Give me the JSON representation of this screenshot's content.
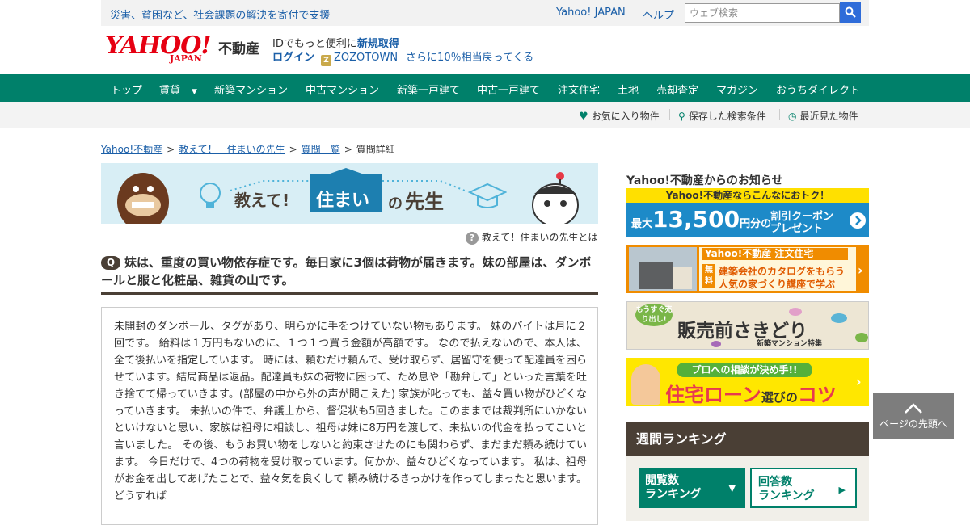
{
  "topbar": {
    "tagline": "災害、貧困など、社会課題の解決を寄付で支援",
    "yahoo_japan": "Yahoo! JAPAN",
    "help": "ヘルプ",
    "search_placeholder": "ウェブ検索"
  },
  "logo": {
    "yahoo": "YAHOO!",
    "japan": "JAPAN",
    "fudosan": "不動産"
  },
  "account": {
    "id_prefix": "IDでもっと便利に",
    "new_id": "新規取得",
    "login": "ログイン",
    "zozo": "ZOZOTOWN",
    "zozo_bonus": "さらに10％相当戻ってくる"
  },
  "nav": [
    "トップ",
    "賃貸",
    "新築マンション",
    "中古マンション",
    "新築一戸建て",
    "中古一戸建て",
    "注文住宅",
    "土地",
    "売却査定",
    "マガジン",
    "おうちダイレクト"
  ],
  "subbar": [
    "お気に入り物件",
    "保存した検索条件",
    "最近見た物件"
  ],
  "breadcrumb": [
    "Yahoo!不動産",
    "教えて！　住まいの先生",
    "質問一覧",
    "質問詳細"
  ],
  "banner": {
    "oshiete": "教えて!",
    "sumai": "住まい",
    "no": "の",
    "sensei": "先生"
  },
  "about_link": "教えて！住まいの先生とは",
  "question": {
    "badge": "Q",
    "title": "妹は、重度の買い物依存症です。毎日家に3個は荷物が届きます。妹の部屋は、ダンボールと服と化粧品、雑貨の山です。",
    "body": "未開封のダンボール、タグがあり、明らかに手をつけていない物もあります。 妹のバイトは月に２回です。 給料は１万円もないのに、１つ１つ買う金額が高額です。 なので払えないので、本人は、全て後払いを指定しています。 時には、頼むだけ頼んで、受け取らず、居留守を使って配達員を困らせています。結局商品は返品。配達員も妹の荷物に困って、ため息や「勘弁して」といった言葉を吐き捨てて帰っていきます。(部屋の中から外の声が聞こえた) 家族が叱っても、益々買い物がひどくなっていきます。 未払いの件で、弁護士から、督促状も5回きました。このままでは裁判所にいかないといけないと思い、家族は祖母に相談し、祖母は妹に8万円を渡して、未払いの代金を払ってこいと言いました。 その後、もうお買い物をしないと約束させたのにも関わらず、まだまだ頼み続けています。 今日だけで、4つの荷物を受け取っています。何かか、益々ひどくなっています。 私は、祖母がお金を出してあげたことで、益々気を良くして 頼み続けるきっかけを作ってしまったと思います。どうすれば"
  },
  "sidebar": {
    "title": "Yahoo!不動産からのお知らせ",
    "ad1": {
      "top": "Yahoo!不動産ならこんなにおトク！",
      "max": "最大",
      "amount": "13,500",
      "unit": "円分の",
      "coupon1": "割引クーポン",
      "coupon2": "プレゼント"
    },
    "ad2": {
      "head": "Yahoo!不動産  注文住宅",
      "free": "無料",
      "line1": "建築会社のカタログをもらう",
      "line2": "人気の家づくり講座で学ぶ"
    },
    "ad3": {
      "badge": "もうすぐ売り出し!",
      "main": "販売前さきどり",
      "sub": "新築マンション特集"
    },
    "ad4": {
      "green": "プロへの相談が決め手!!",
      "main1": "住宅ローン",
      "main2": "選び",
      "main3": "の",
      "main4": "コツ"
    },
    "ranking_title": "週間ランキング",
    "ranking_tabs": [
      {
        "line1": "閲覧数",
        "line2": "ランキング"
      },
      {
        "line1": "回答数",
        "line2": "ランキング"
      }
    ]
  },
  "totop": "ページの先頭へ",
  "colors": {
    "brand_green": "#00806a",
    "brown": "#4a3f35",
    "link_blue": "#1b5fa8",
    "yahoo_red": "#e60012"
  }
}
